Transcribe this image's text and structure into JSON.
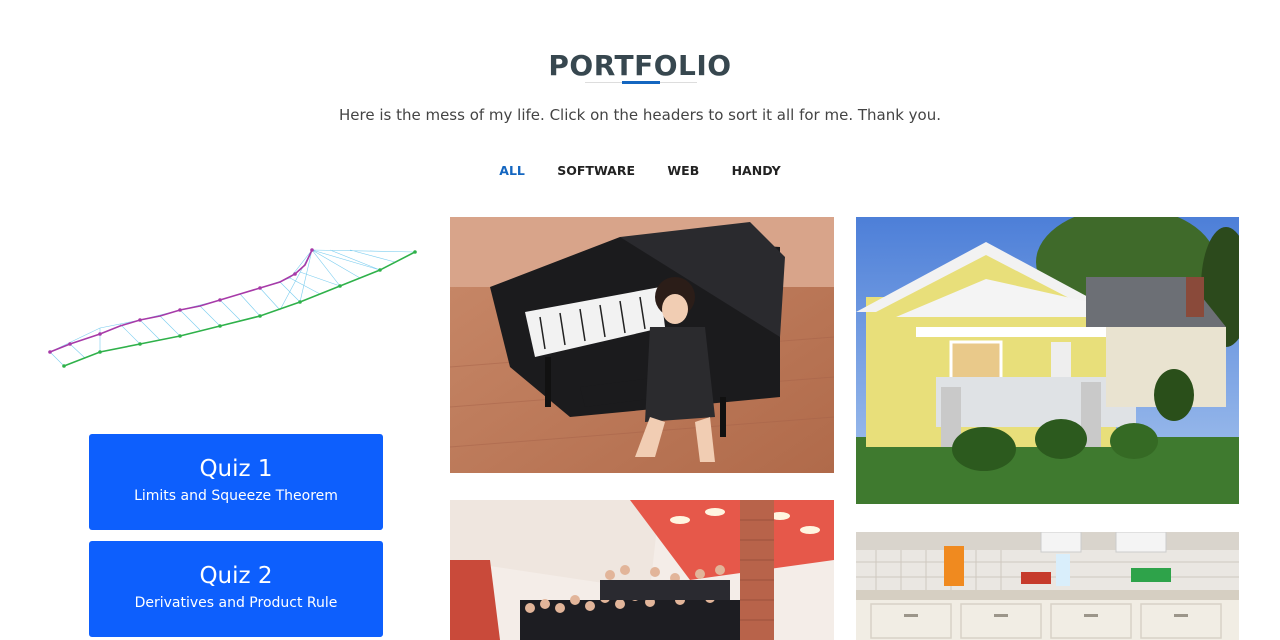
{
  "header": {
    "title": "PORTFOLIO",
    "subtitle": "Here is the mess of my life. Click on the headers to sort it all for me. Thank you."
  },
  "filters": [
    {
      "label": "ALL",
      "active": true
    },
    {
      "label": "SOFTWARE",
      "active": false
    },
    {
      "label": "WEB",
      "active": false
    },
    {
      "label": "HANDY",
      "active": false
    }
  ],
  "quizzes": [
    {
      "title": "Quiz 1",
      "subtitle": "Limits and Squeeze Theorem"
    },
    {
      "title": "Quiz 2",
      "subtitle": "Derivatives and Product Rule"
    }
  ],
  "colors": {
    "accent": "#1466c0",
    "quiz_button": "#0d5ffd",
    "heading": "#37474f"
  }
}
